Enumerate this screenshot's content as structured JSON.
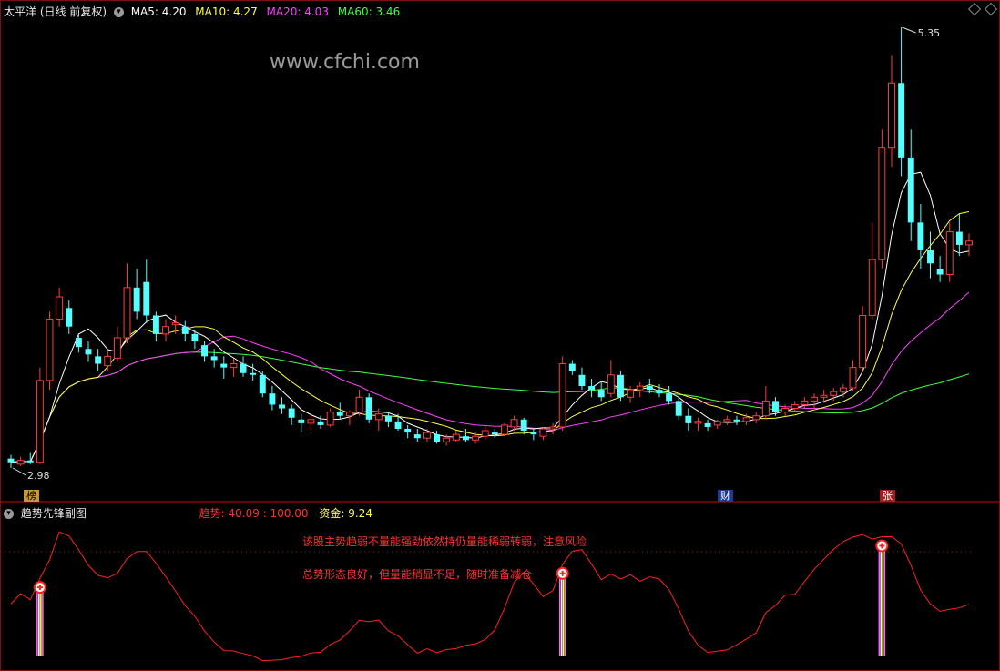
{
  "header": {
    "stock_name": "太平洋",
    "period_label": "(日线 前复权)",
    "ma": [
      {
        "label": "MA5: 4.20",
        "color": "#ffffff"
      },
      {
        "label": "MA10: 4.27",
        "color": "#ffff40"
      },
      {
        "label": "MA20: 4.03",
        "color": "#ff40ff"
      },
      {
        "label": "MA60: 3.46",
        "color": "#40ff40"
      }
    ]
  },
  "watermark": "www.cfchi.com",
  "price_marks": {
    "high": "5.35",
    "low": "2.98"
  },
  "event_marks": [
    {
      "text": "榜",
      "bg": "#c8963c",
      "color": "#000"
    },
    {
      "text": "财",
      "bg": "#1e3c8c",
      "color": "#ffffff"
    },
    {
      "text": "张",
      "bg": "#a01e1e",
      "color": "#ffffff"
    }
  ],
  "indicator": {
    "name": "趋势先锋副图",
    "trend_label": "趋势: 40.09 : 100.00",
    "fund_label": "资金: 9.24",
    "note1": "该股主势趋弱不量能强劲依然持仍量能稀弱转弱，注意风险",
    "note2": "总势形态良好，但量能稍显不足，随时准备减仓"
  },
  "colors": {
    "up": "#ff3c3c",
    "down": "#54ffff",
    "ma5": "#ffffff",
    "ma10": "#ffff40",
    "ma20": "#ff40ff",
    "ma60": "#40ff40",
    "trend": "#ff2020"
  },
  "chart_data": {
    "type": "candlestick",
    "price_range": [
      2.95,
      5.35
    ],
    "indicator_range": [
      0,
      100
    ],
    "candles": [
      [
        3.03,
        3.05,
        2.98,
        3.01
      ],
      [
        3.0,
        3.04,
        2.99,
        3.02
      ],
      [
        3.02,
        3.06,
        3.0,
        3.01
      ],
      [
        3.01,
        3.52,
        3.0,
        3.45
      ],
      [
        3.45,
        3.82,
        3.4,
        3.78
      ],
      [
        3.78,
        3.95,
        3.74,
        3.9
      ],
      [
        3.84,
        3.88,
        3.7,
        3.74
      ],
      [
        3.68,
        3.7,
        3.6,
        3.63
      ],
      [
        3.62,
        3.66,
        3.55,
        3.59
      ],
      [
        3.58,
        3.62,
        3.5,
        3.54
      ],
      [
        3.53,
        3.61,
        3.5,
        3.58
      ],
      [
        3.57,
        3.74,
        3.55,
        3.68
      ],
      [
        3.68,
        4.08,
        3.65,
        3.95
      ],
      [
        3.95,
        4.05,
        3.78,
        3.82
      ],
      [
        3.98,
        4.1,
        3.76,
        3.8
      ],
      [
        3.8,
        3.82,
        3.66,
        3.7
      ],
      [
        3.7,
        3.78,
        3.66,
        3.74
      ],
      [
        3.75,
        3.8,
        3.7,
        3.76
      ],
      [
        3.74,
        3.77,
        3.66,
        3.7
      ],
      [
        3.7,
        3.72,
        3.62,
        3.66
      ],
      [
        3.64,
        3.66,
        3.55,
        3.58
      ],
      [
        3.58,
        3.62,
        3.52,
        3.56
      ],
      [
        3.54,
        3.58,
        3.46,
        3.52
      ],
      [
        3.52,
        3.57,
        3.47,
        3.54
      ],
      [
        3.54,
        3.58,
        3.47,
        3.49
      ],
      [
        3.49,
        3.54,
        3.45,
        3.48
      ],
      [
        3.48,
        3.5,
        3.36,
        3.38
      ],
      [
        3.38,
        3.42,
        3.29,
        3.32
      ],
      [
        3.32,
        3.36,
        3.27,
        3.3
      ],
      [
        3.3,
        3.32,
        3.21,
        3.25
      ],
      [
        3.24,
        3.27,
        3.17,
        3.22
      ],
      [
        3.22,
        3.26,
        3.18,
        3.24
      ],
      [
        3.23,
        3.26,
        3.19,
        3.21
      ],
      [
        3.21,
        3.3,
        3.2,
        3.28
      ],
      [
        3.28,
        3.33,
        3.24,
        3.26
      ],
      [
        3.26,
        3.29,
        3.21,
        3.28
      ],
      [
        3.28,
        3.4,
        3.26,
        3.36
      ],
      [
        3.36,
        3.38,
        3.22,
        3.24
      ],
      [
        3.24,
        3.3,
        3.18,
        3.27
      ],
      [
        3.26,
        3.28,
        3.2,
        3.23
      ],
      [
        3.23,
        3.27,
        3.18,
        3.19
      ],
      [
        3.19,
        3.21,
        3.14,
        3.17
      ],
      [
        3.16,
        3.19,
        3.12,
        3.14
      ],
      [
        3.14,
        3.19,
        3.12,
        3.17
      ],
      [
        3.16,
        3.18,
        3.11,
        3.12
      ],
      [
        3.12,
        3.16,
        3.1,
        3.14
      ],
      [
        3.13,
        3.18,
        3.12,
        3.16
      ],
      [
        3.15,
        3.19,
        3.12,
        3.13
      ],
      [
        3.13,
        3.17,
        3.11,
        3.15
      ],
      [
        3.15,
        3.2,
        3.13,
        3.18
      ],
      [
        3.17,
        3.19,
        3.14,
        3.16
      ],
      [
        3.16,
        3.22,
        3.15,
        3.21
      ],
      [
        3.2,
        3.26,
        3.18,
        3.24
      ],
      [
        3.24,
        3.25,
        3.16,
        3.18
      ],
      [
        3.17,
        3.19,
        3.13,
        3.16
      ],
      [
        3.15,
        3.2,
        3.13,
        3.19
      ],
      [
        3.19,
        3.22,
        3.16,
        3.2
      ],
      [
        3.2,
        3.58,
        3.18,
        3.54
      ],
      [
        3.54,
        3.56,
        3.48,
        3.5
      ],
      [
        3.48,
        3.52,
        3.4,
        3.42
      ],
      [
        3.42,
        3.46,
        3.36,
        3.4
      ],
      [
        3.4,
        3.45,
        3.34,
        3.36
      ],
      [
        3.38,
        3.56,
        3.36,
        3.48
      ],
      [
        3.48,
        3.5,
        3.34,
        3.36
      ],
      [
        3.36,
        3.42,
        3.33,
        3.4
      ],
      [
        3.4,
        3.44,
        3.36,
        3.42
      ],
      [
        3.42,
        3.46,
        3.38,
        3.4
      ],
      [
        3.4,
        3.43,
        3.36,
        3.38
      ],
      [
        3.38,
        3.42,
        3.32,
        3.34
      ],
      [
        3.34,
        3.36,
        3.24,
        3.26
      ],
      [
        3.26,
        3.3,
        3.18,
        3.22
      ],
      [
        3.22,
        3.25,
        3.18,
        3.23
      ],
      [
        3.22,
        3.24,
        3.18,
        3.2
      ],
      [
        3.21,
        3.24,
        3.19,
        3.23
      ],
      [
        3.23,
        3.26,
        3.21,
        3.24
      ],
      [
        3.24,
        3.26,
        3.21,
        3.23
      ],
      [
        3.23,
        3.27,
        3.21,
        3.25
      ],
      [
        3.24,
        3.28,
        3.22,
        3.26
      ],
      [
        3.26,
        3.42,
        3.24,
        3.34
      ],
      [
        3.34,
        3.36,
        3.26,
        3.28
      ],
      [
        3.28,
        3.32,
        3.26,
        3.3
      ],
      [
        3.3,
        3.34,
        3.28,
        3.32
      ],
      [
        3.32,
        3.36,
        3.3,
        3.34
      ],
      [
        3.34,
        3.38,
        3.3,
        3.36
      ],
      [
        3.36,
        3.4,
        3.33,
        3.37
      ],
      [
        3.37,
        3.41,
        3.34,
        3.39
      ],
      [
        3.39,
        3.43,
        3.36,
        3.41
      ],
      [
        3.41,
        3.56,
        3.39,
        3.52
      ],
      [
        3.52,
        3.85,
        3.5,
        3.8
      ],
      [
        3.8,
        4.3,
        3.78,
        4.1
      ],
      [
        4.1,
        4.8,
        4.05,
        4.7
      ],
      [
        4.7,
        5.2,
        4.6,
        5.05
      ],
      [
        5.05,
        5.35,
        4.55,
        4.65
      ],
      [
        4.65,
        4.8,
        4.2,
        4.3
      ],
      [
        4.3,
        4.4,
        4.05,
        4.15
      ],
      [
        4.15,
        4.25,
        4.0,
        4.08
      ],
      [
        4.05,
        4.12,
        3.98,
        4.02
      ],
      [
        4.02,
        4.3,
        3.98,
        4.25
      ],
      [
        4.25,
        4.35,
        4.12,
        4.18
      ],
      [
        4.18,
        4.24,
        4.12,
        4.2
      ]
    ]
  }
}
